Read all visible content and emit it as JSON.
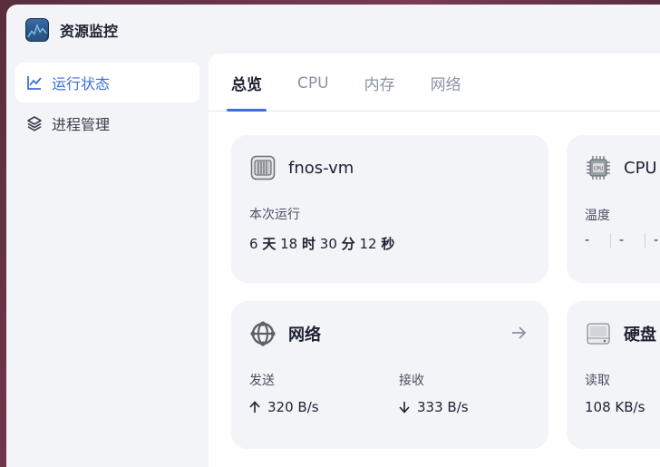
{
  "app": {
    "title": "资源监控",
    "logo_icon": "activity-monitor-icon"
  },
  "sidebar": {
    "items": [
      {
        "label": "运行状态",
        "icon": "line-chart-icon",
        "active": true
      },
      {
        "label": "进程管理",
        "icon": "layers-icon",
        "active": false
      }
    ]
  },
  "tabs": [
    {
      "label": "总览",
      "active": true
    },
    {
      "label": "CPU",
      "active": false
    },
    {
      "label": "内存",
      "active": false
    },
    {
      "label": "网络",
      "active": false
    }
  ],
  "cards": {
    "system": {
      "title": "fnos-vm",
      "uptime_label": "本次运行",
      "uptime": {
        "days": "6",
        "days_unit": "天",
        "hours": "18",
        "hours_unit": "时",
        "minutes": "30",
        "minutes_unit": "分",
        "seconds": "12",
        "seconds_unit": "秒"
      }
    },
    "cpu": {
      "title": "CPU",
      "temp_label": "温度",
      "temps": [
        "-",
        "-",
        "-",
        ""
      ]
    },
    "network": {
      "title": "网络",
      "send_label": "发送",
      "send_value": "320 B/s",
      "recv_label": "接收",
      "recv_value": "333 B/s"
    },
    "disk": {
      "title": "硬盘",
      "read_label": "读取",
      "read_value": "108 KB/s"
    }
  },
  "colors": {
    "accent": "#3b6fd6",
    "sidebar_bg": "#f3f4f7",
    "card_bg": "#f3f4f7"
  }
}
